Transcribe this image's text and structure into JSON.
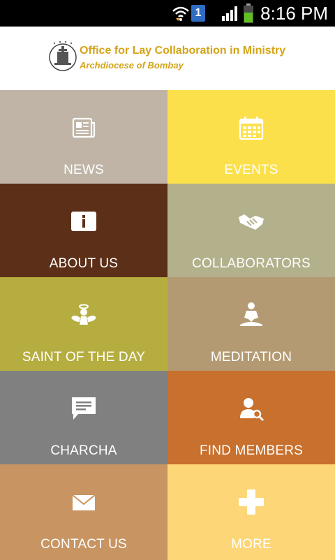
{
  "status_bar": {
    "time": "8:16 PM",
    "sim_number": "1",
    "icons": [
      "wifi-icon",
      "sim-icon",
      "signal-icon",
      "battery-icon"
    ]
  },
  "header": {
    "title": "Office for Lay Collaboration in Ministry",
    "subtitle": "Archdiocese of Bombay",
    "brand_color": "#d3a417"
  },
  "tiles": [
    {
      "label": "NEWS",
      "icon": "newspaper-icon",
      "color": "#bfb4a6"
    },
    {
      "label": "EVENTS",
      "icon": "calendar-icon",
      "color": "#fce04b"
    },
    {
      "label": "ABOUT US",
      "icon": "info-icon",
      "color": "#5c2f18"
    },
    {
      "label": "COLLABORATORS",
      "icon": "handshake-icon",
      "color": "#b3b08c"
    },
    {
      "label": "SAINT OF THE DAY",
      "icon": "angel-icon",
      "color": "#b5ad40"
    },
    {
      "label": "MEDITATION",
      "icon": "meditation-icon",
      "color": "#b49a73"
    },
    {
      "label": "CHARCHA",
      "icon": "chat-icon",
      "color": "#808080"
    },
    {
      "label": "FIND MEMBERS",
      "icon": "search-user-icon",
      "color": "#c8702d"
    },
    {
      "label": "CONTACT US",
      "icon": "envelope-icon",
      "color": "#c89461"
    },
    {
      "label": "MORE",
      "icon": "plus-icon",
      "color": "#fcd677"
    }
  ]
}
